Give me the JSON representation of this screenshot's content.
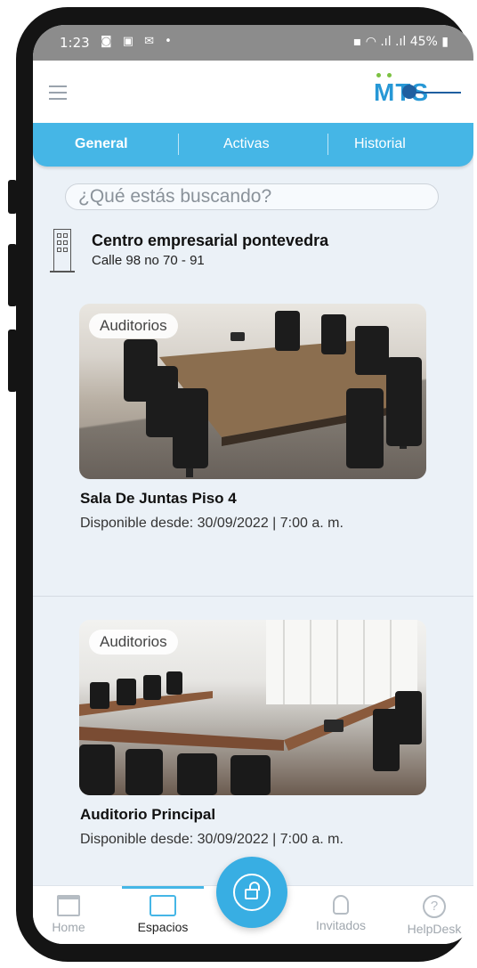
{
  "status_bar": {
    "time": "1:23",
    "notification_icons": "◙ ▣ ✉ •",
    "battery": "45%"
  },
  "header": {
    "logo_text": "MTS"
  },
  "tabs": [
    {
      "label": "General",
      "active": true
    },
    {
      "label": "Activas",
      "active": false
    },
    {
      "label": "Historial",
      "active": false
    }
  ],
  "search": {
    "placeholder": "¿Qué estás  buscando?"
  },
  "building": {
    "name": "Centro empresarial pontevedra",
    "address": "Calle 98 no 70 - 91"
  },
  "spaces": [
    {
      "tag": "Auditorios",
      "name": "Sala De Juntas Piso 4",
      "availability": "Disponible desde:  30/09/2022  |  7:00 a. m."
    },
    {
      "tag": "Auditorios",
      "name": "Auditorio Principal",
      "availability": "Disponible desde:  30/09/2022  |  7:00 a. m."
    }
  ],
  "bottom_nav": [
    {
      "label": "Home",
      "icon": "store-icon",
      "active": false
    },
    {
      "label": "Espacios",
      "icon": "meeting-room-icon",
      "active": true
    },
    {
      "label": "Invitados",
      "icon": "person-icon",
      "active": false
    },
    {
      "label": "HelpDesk",
      "icon": "help-circle-icon",
      "active": false
    }
  ],
  "fab": {
    "icon": "unlock-icon"
  },
  "colors": {
    "primary": "#45b6e6",
    "logo": "#2798d6",
    "background": "#ebf1f7"
  }
}
